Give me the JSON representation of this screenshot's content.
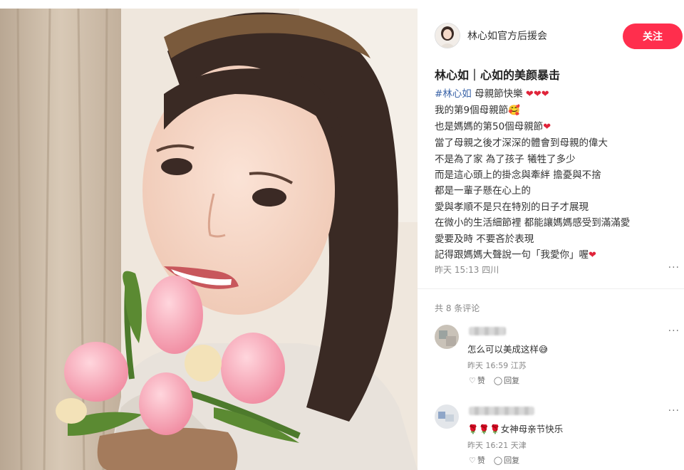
{
  "post": {
    "author_name": "林心如官方后援会",
    "follow_label": "关注",
    "title": "林心如｜心如的美颜暴击",
    "lines": [
      "母親節快樂",
      "我的第9個母親節",
      "也是媽媽的第50個母親節",
      "當了母親之後才深深的體會到母親的偉大",
      "不是為了家  為了孩子  犧牲了多少",
      "而是這心頭上的掛念與牽絆   擔憂與不捨",
      "都是一輩子懸在心上的",
      "愛與孝順不是只在特別的日子才展現",
      "在微小的生活細節裡  都能讓媽媽感受到滿滿愛",
      "愛要及時  不要吝於表現",
      "記得跟媽媽大聲說一句「我愛你」喔"
    ],
    "hashtag": "#林心如",
    "meta": "昨天 15:13 四川",
    "more": "···"
  },
  "comments_header": "共 8 条评论",
  "comments": [
    {
      "text": "怎么可以美成这样",
      "meta": "昨天 16:59 江苏",
      "like": "赞",
      "reply": "回复",
      "more": "···"
    },
    {
      "text": "女神母亲节快乐",
      "meta": "昨天 16:21 天津",
      "like": "赞",
      "reply": "回复",
      "more": "···"
    }
  ],
  "colors": {
    "accent": "#ff2e4d",
    "hashtag": "#3b64a8",
    "heart": "#e0243a"
  },
  "icons": [
    "heart-icon",
    "smile-emoji-icon",
    "like-icon",
    "reply-icon",
    "more-icon"
  ]
}
